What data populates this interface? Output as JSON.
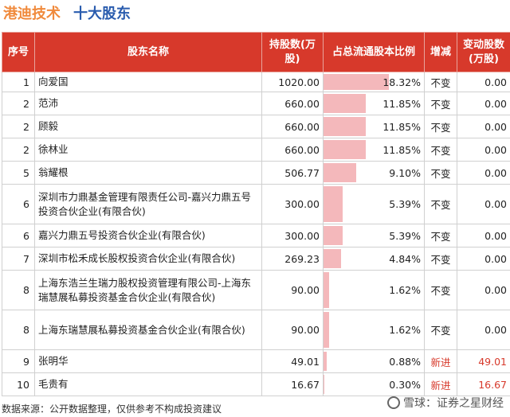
{
  "header": {
    "company": "港迪技术",
    "subtitle": "十大股东"
  },
  "table": {
    "columns": [
      "序号",
      "股东名称",
      "持股数(万股)",
      "占总流通股本比例",
      "增减",
      "变动股数(万股)"
    ],
    "rows": [
      {
        "idx": "1",
        "name": "向爱国",
        "shares": "1020.00",
        "ratio_value": 18.32,
        "ratio": "18.32%",
        "change": "不变",
        "delta": "0.00"
      },
      {
        "idx": "2",
        "name": "范沛",
        "shares": "660.00",
        "ratio_value": 11.85,
        "ratio": "11.85%",
        "change": "不变",
        "delta": "0.00"
      },
      {
        "idx": "2",
        "name": "顾毅",
        "shares": "660.00",
        "ratio_value": 11.85,
        "ratio": "11.85%",
        "change": "不变",
        "delta": "0.00"
      },
      {
        "idx": "2",
        "name": "徐林业",
        "shares": "660.00",
        "ratio_value": 11.85,
        "ratio": "11.85%",
        "change": "不变",
        "delta": "0.00"
      },
      {
        "idx": "5",
        "name": "翁耀根",
        "shares": "506.77",
        "ratio_value": 9.1,
        "ratio": "9.10%",
        "change": "不变",
        "delta": "0.00"
      },
      {
        "idx": "6",
        "name": "深圳市力鼎基金管理有限责任公司-嘉兴力鼎五号投资合伙企业(有限合伙)",
        "shares": "300.00",
        "ratio_value": 5.39,
        "ratio": "5.39%",
        "change": "不变",
        "delta": "0.00"
      },
      {
        "idx": "6",
        "name": "嘉兴力鼎五号投资合伙企业(有限合伙)",
        "shares": "300.00",
        "ratio_value": 5.39,
        "ratio": "5.39%",
        "change": "不变",
        "delta": "0.00"
      },
      {
        "idx": "7",
        "name": "深圳市松禾成长股权投资合伙企业(有限合伙)",
        "shares": "269.23",
        "ratio_value": 4.84,
        "ratio": "4.84%",
        "change": "不变",
        "delta": "0.00"
      },
      {
        "idx": "8",
        "name": "上海东浩兰生瑞力股权投资管理有限公司-上海东瑞慧展私募投资基金合伙企业(有限合伙)",
        "shares": "90.00",
        "ratio_value": 1.62,
        "ratio": "1.62%",
        "change": "不变",
        "delta": "0.00"
      },
      {
        "idx": "8",
        "name": "上海东瑞慧展私募投资基金合伙企业(有限合伙)",
        "shares": "90.00",
        "ratio_value": 1.62,
        "ratio": "1.62%",
        "change": "不变",
        "delta": "0.00"
      },
      {
        "idx": "9",
        "name": "张明华",
        "shares": "49.01",
        "ratio_value": 0.88,
        "ratio": "0.88%",
        "change": "新进",
        "delta": "49.01"
      },
      {
        "idx": "10",
        "name": "毛贵有",
        "shares": "16.67",
        "ratio_value": 0.3,
        "ratio": "0.30%",
        "change": "新进",
        "delta": "16.67"
      }
    ]
  },
  "footer": {
    "source": "数据来源：公开数据整理，仅供参考不构成投资建议",
    "brand": "雪球：证券之星财经"
  },
  "colors": {
    "header_bg": "#d7392b",
    "ratio_bar": "#f4b8bb",
    "new_text": "#d7392b",
    "title_company": "#f08a3c",
    "title_subtitle": "#2a5cae"
  }
}
